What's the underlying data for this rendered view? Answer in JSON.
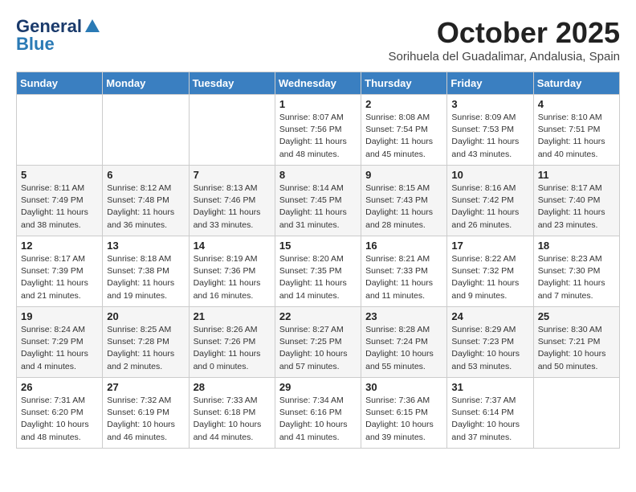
{
  "header": {
    "logo_line1": "General",
    "logo_line2": "Blue",
    "month": "October 2025",
    "subtitle": "Sorihuela del Guadalimar, Andalusia, Spain"
  },
  "weekdays": [
    "Sunday",
    "Monday",
    "Tuesday",
    "Wednesday",
    "Thursday",
    "Friday",
    "Saturday"
  ],
  "weeks": [
    [
      {
        "day": "",
        "info": ""
      },
      {
        "day": "",
        "info": ""
      },
      {
        "day": "",
        "info": ""
      },
      {
        "day": "1",
        "info": "Sunrise: 8:07 AM\nSunset: 7:56 PM\nDaylight: 11 hours\nand 48 minutes."
      },
      {
        "day": "2",
        "info": "Sunrise: 8:08 AM\nSunset: 7:54 PM\nDaylight: 11 hours\nand 45 minutes."
      },
      {
        "day": "3",
        "info": "Sunrise: 8:09 AM\nSunset: 7:53 PM\nDaylight: 11 hours\nand 43 minutes."
      },
      {
        "day": "4",
        "info": "Sunrise: 8:10 AM\nSunset: 7:51 PM\nDaylight: 11 hours\nand 40 minutes."
      }
    ],
    [
      {
        "day": "5",
        "info": "Sunrise: 8:11 AM\nSunset: 7:49 PM\nDaylight: 11 hours\nand 38 minutes."
      },
      {
        "day": "6",
        "info": "Sunrise: 8:12 AM\nSunset: 7:48 PM\nDaylight: 11 hours\nand 36 minutes."
      },
      {
        "day": "7",
        "info": "Sunrise: 8:13 AM\nSunset: 7:46 PM\nDaylight: 11 hours\nand 33 minutes."
      },
      {
        "day": "8",
        "info": "Sunrise: 8:14 AM\nSunset: 7:45 PM\nDaylight: 11 hours\nand 31 minutes."
      },
      {
        "day": "9",
        "info": "Sunrise: 8:15 AM\nSunset: 7:43 PM\nDaylight: 11 hours\nand 28 minutes."
      },
      {
        "day": "10",
        "info": "Sunrise: 8:16 AM\nSunset: 7:42 PM\nDaylight: 11 hours\nand 26 minutes."
      },
      {
        "day": "11",
        "info": "Sunrise: 8:17 AM\nSunset: 7:40 PM\nDaylight: 11 hours\nand 23 minutes."
      }
    ],
    [
      {
        "day": "12",
        "info": "Sunrise: 8:17 AM\nSunset: 7:39 PM\nDaylight: 11 hours\nand 21 minutes."
      },
      {
        "day": "13",
        "info": "Sunrise: 8:18 AM\nSunset: 7:38 PM\nDaylight: 11 hours\nand 19 minutes."
      },
      {
        "day": "14",
        "info": "Sunrise: 8:19 AM\nSunset: 7:36 PM\nDaylight: 11 hours\nand 16 minutes."
      },
      {
        "day": "15",
        "info": "Sunrise: 8:20 AM\nSunset: 7:35 PM\nDaylight: 11 hours\nand 14 minutes."
      },
      {
        "day": "16",
        "info": "Sunrise: 8:21 AM\nSunset: 7:33 PM\nDaylight: 11 hours\nand 11 minutes."
      },
      {
        "day": "17",
        "info": "Sunrise: 8:22 AM\nSunset: 7:32 PM\nDaylight: 11 hours\nand 9 minutes."
      },
      {
        "day": "18",
        "info": "Sunrise: 8:23 AM\nSunset: 7:30 PM\nDaylight: 11 hours\nand 7 minutes."
      }
    ],
    [
      {
        "day": "19",
        "info": "Sunrise: 8:24 AM\nSunset: 7:29 PM\nDaylight: 11 hours\nand 4 minutes."
      },
      {
        "day": "20",
        "info": "Sunrise: 8:25 AM\nSunset: 7:28 PM\nDaylight: 11 hours\nand 2 minutes."
      },
      {
        "day": "21",
        "info": "Sunrise: 8:26 AM\nSunset: 7:26 PM\nDaylight: 11 hours\nand 0 minutes."
      },
      {
        "day": "22",
        "info": "Sunrise: 8:27 AM\nSunset: 7:25 PM\nDaylight: 10 hours\nand 57 minutes."
      },
      {
        "day": "23",
        "info": "Sunrise: 8:28 AM\nSunset: 7:24 PM\nDaylight: 10 hours\nand 55 minutes."
      },
      {
        "day": "24",
        "info": "Sunrise: 8:29 AM\nSunset: 7:23 PM\nDaylight: 10 hours\nand 53 minutes."
      },
      {
        "day": "25",
        "info": "Sunrise: 8:30 AM\nSunset: 7:21 PM\nDaylight: 10 hours\nand 50 minutes."
      }
    ],
    [
      {
        "day": "26",
        "info": "Sunrise: 7:31 AM\nSunset: 6:20 PM\nDaylight: 10 hours\nand 48 minutes."
      },
      {
        "day": "27",
        "info": "Sunrise: 7:32 AM\nSunset: 6:19 PM\nDaylight: 10 hours\nand 46 minutes."
      },
      {
        "day": "28",
        "info": "Sunrise: 7:33 AM\nSunset: 6:18 PM\nDaylight: 10 hours\nand 44 minutes."
      },
      {
        "day": "29",
        "info": "Sunrise: 7:34 AM\nSunset: 6:16 PM\nDaylight: 10 hours\nand 41 minutes."
      },
      {
        "day": "30",
        "info": "Sunrise: 7:36 AM\nSunset: 6:15 PM\nDaylight: 10 hours\nand 39 minutes."
      },
      {
        "day": "31",
        "info": "Sunrise: 7:37 AM\nSunset: 6:14 PM\nDaylight: 10 hours\nand 37 minutes."
      },
      {
        "day": "",
        "info": ""
      }
    ]
  ]
}
